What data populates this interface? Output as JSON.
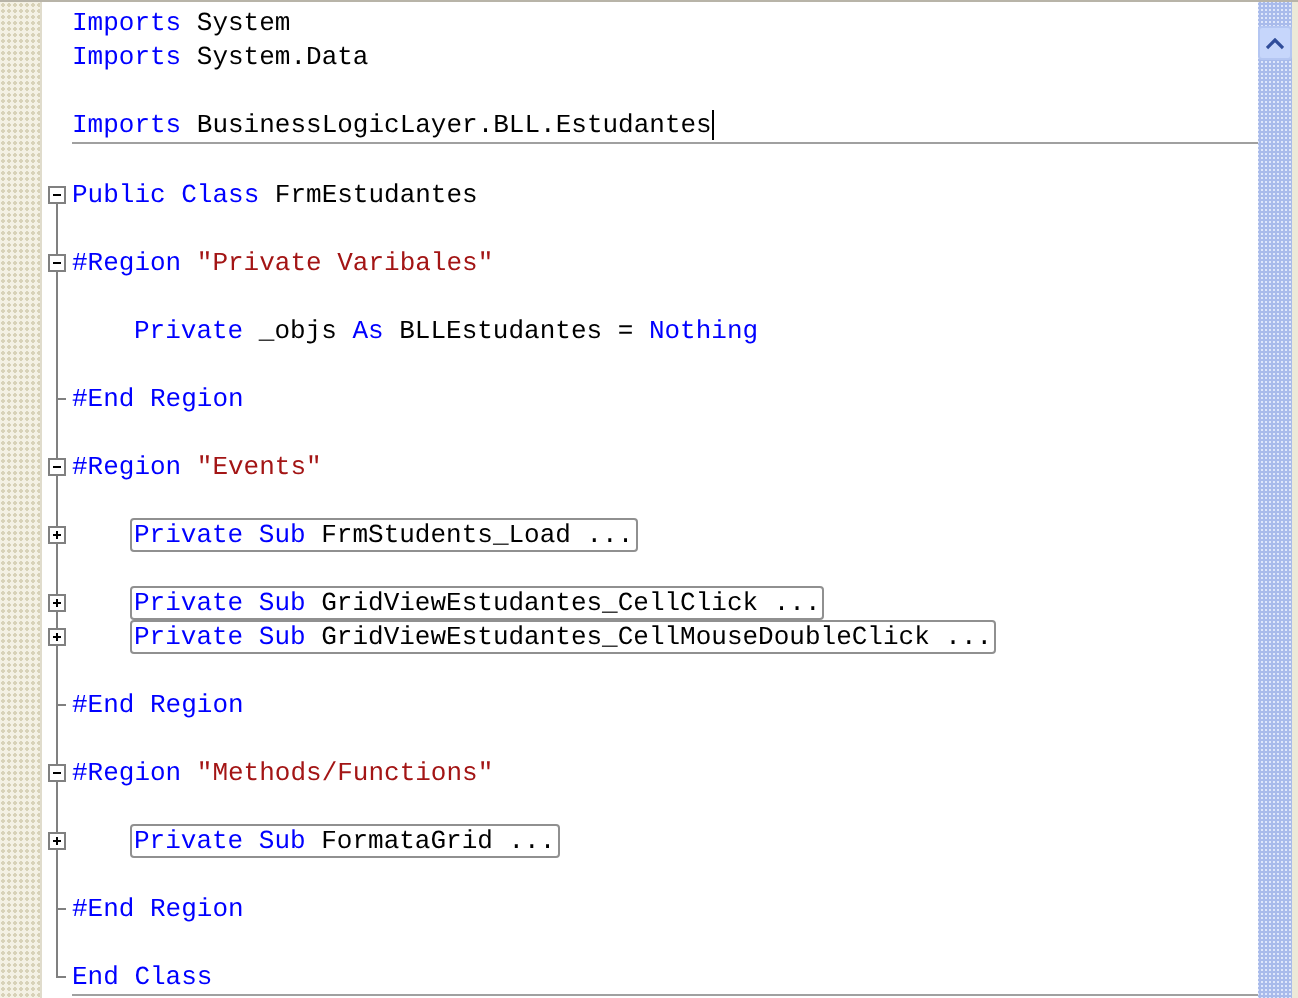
{
  "lines": [
    {
      "kind": "plain",
      "indent": false,
      "caret": false,
      "separator_after": false,
      "tokens": [
        {
          "kind": "keyword",
          "text": "Imports"
        },
        {
          "kind": "plain",
          "text": "System"
        }
      ]
    },
    {
      "kind": "plain",
      "indent": false,
      "caret": false,
      "separator_after": false,
      "tokens": [
        {
          "kind": "keyword",
          "text": "Imports"
        },
        {
          "kind": "plain",
          "text": "System.Data"
        }
      ]
    },
    {
      "kind": "blank"
    },
    {
      "kind": "plain",
      "indent": false,
      "caret": true,
      "separator_after": true,
      "tokens": [
        {
          "kind": "keyword",
          "text": "Imports"
        },
        {
          "kind": "plain",
          "text": "BusinessLogicLayer.BLL.Estudantes"
        }
      ]
    },
    {
      "kind": "blank"
    },
    {
      "kind": "expanded",
      "indent": false,
      "caret": false,
      "separator_after": false,
      "tokens": [
        {
          "kind": "keyword",
          "text": "Public Class"
        },
        {
          "kind": "plain",
          "text": "FrmEstudantes"
        }
      ]
    },
    {
      "kind": "blank_guide"
    },
    {
      "kind": "expanded",
      "indent": false,
      "caret": false,
      "separator_after": false,
      "tokens": [
        {
          "kind": "keyword",
          "text": "#Region"
        },
        {
          "kind": "string",
          "text": "\"Private Varibales\""
        }
      ]
    },
    {
      "kind": "blank_guide"
    },
    {
      "kind": "guide",
      "indent": true,
      "caret": false,
      "separator_after": false,
      "tokens": [
        {
          "kind": "keyword",
          "text": "Private"
        },
        {
          "kind": "plain",
          "text": "_objs"
        },
        {
          "kind": "keyword",
          "text": "As"
        },
        {
          "kind": "plain",
          "text": "BLLEstudantes ="
        },
        {
          "kind": "keyword",
          "text": "Nothing"
        }
      ]
    },
    {
      "kind": "blank_guide"
    },
    {
      "kind": "end",
      "indent": false,
      "caret": false,
      "separator_after": false,
      "tokens": [
        {
          "kind": "keyword",
          "text": "#End Region"
        }
      ]
    },
    {
      "kind": "blank_guide"
    },
    {
      "kind": "expanded",
      "indent": false,
      "caret": false,
      "separator_after": false,
      "tokens": [
        {
          "kind": "keyword",
          "text": "#Region"
        },
        {
          "kind": "string",
          "text": "\"Events\""
        }
      ]
    },
    {
      "kind": "blank_guide"
    },
    {
      "kind": "collapsed",
      "indent": true,
      "caret": false,
      "separator_after": false,
      "tokens": [
        {
          "kind": "keyword",
          "text": "Private Sub"
        },
        {
          "kind": "plain",
          "text": "FrmStudents_Load ..."
        }
      ]
    },
    {
      "kind": "blank_guide"
    },
    {
      "kind": "collapsed",
      "indent": true,
      "caret": false,
      "separator_after": false,
      "tokens": [
        {
          "kind": "keyword",
          "text": "Private Sub"
        },
        {
          "kind": "plain",
          "text": "GridViewEstudantes_CellClick ..."
        }
      ]
    },
    {
      "kind": "collapsed",
      "indent": true,
      "caret": false,
      "separator_after": false,
      "tokens": [
        {
          "kind": "keyword",
          "text": "Private Sub"
        },
        {
          "kind": "plain",
          "text": "GridViewEstudantes_CellMouseDoubleClick ..."
        }
      ]
    },
    {
      "kind": "blank_guide"
    },
    {
      "kind": "end",
      "indent": false,
      "caret": false,
      "separator_after": false,
      "tokens": [
        {
          "kind": "keyword",
          "text": "#End Region"
        }
      ]
    },
    {
      "kind": "blank_guide"
    },
    {
      "kind": "expanded",
      "indent": false,
      "caret": false,
      "separator_after": false,
      "tokens": [
        {
          "kind": "keyword",
          "text": "#Region"
        },
        {
          "kind": "string",
          "text": "\"Methods/Functions\""
        }
      ]
    },
    {
      "kind": "blank_guide"
    },
    {
      "kind": "collapsed",
      "indent": true,
      "caret": false,
      "separator_after": false,
      "tokens": [
        {
          "kind": "keyword",
          "text": "Private Sub"
        },
        {
          "kind": "plain",
          "text": "FormataGrid ..."
        }
      ]
    },
    {
      "kind": "blank_guide"
    },
    {
      "kind": "end",
      "indent": false,
      "caret": false,
      "separator_after": false,
      "tokens": [
        {
          "kind": "keyword",
          "text": "#End Region"
        }
      ]
    },
    {
      "kind": "blank_guide"
    },
    {
      "kind": "last",
      "indent": false,
      "caret": false,
      "separator_after": true,
      "tokens": [
        {
          "kind": "keyword",
          "text": "End Class"
        }
      ]
    }
  ]
}
